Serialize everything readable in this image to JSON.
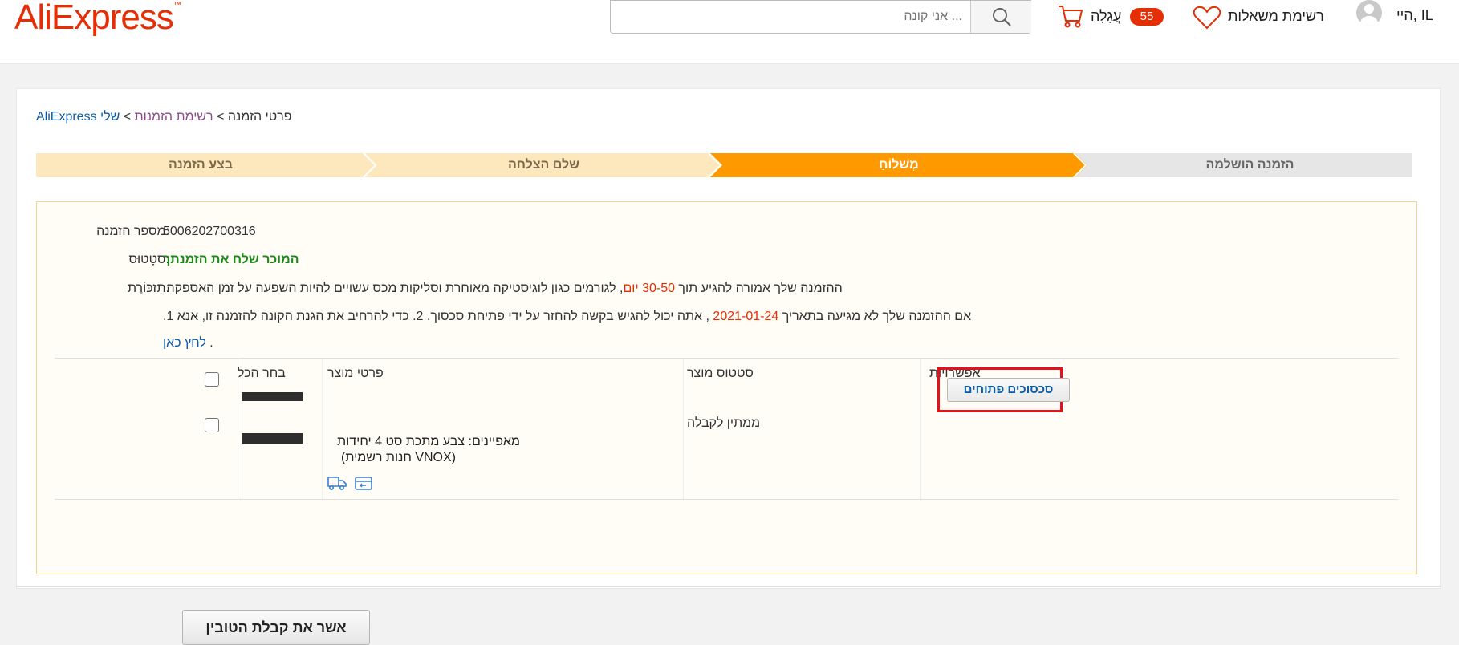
{
  "header": {
    "logo": "AliExpress",
    "logo_tm": "™",
    "search_placeholder": "... אני קונה",
    "cart_label": "עֲגָלָה",
    "cart_count": "55",
    "wishlist_label": "רשימת משאלות",
    "account_greeting": "היי, IL"
  },
  "breadcrumb": {
    "home": "AliExpress",
    "sep1": " > ",
    "mine": "שלי",
    "orders": "רשימת הזמנות",
    "sep2": "> ",
    "current": "פרטי הזמנה"
  },
  "steps": [
    {
      "label": "הזמנה הושלמה",
      "state": "pending"
    },
    {
      "label": "מְשׁלוֹחַ",
      "state": "active"
    },
    {
      "label": "שלם הצלחה",
      "state": "done"
    },
    {
      "label": "בצע הזמנה",
      "state": "done"
    }
  ],
  "order": {
    "number_label": "מספר הזמנה:",
    "number_value": "5006202700316",
    "status_label": "סטָטוּס:",
    "status_value": "המוכר שלח את הזמנתך",
    "reminder_label": "תִזכּוֹרֶת:",
    "reminder_line1_a": "ההזמנה שלך אמורה להגיע תוך ",
    "reminder_line1_days": "30-50 יום",
    "reminder_line1_b": ", לגורמים כגון לוגיסטיקה מאוחרת וסליקות מכס עשויים להיות השפעה על זמן האספקה.",
    "reminder_line2_a": "אם ההזמנה שלך לא מגיעה בתאריך ",
    "reminder_line2_date": "2021-01-24",
    "reminder_line2_b": " , אתה יכול להגיש בקשה להחזר על ידי פתיחת סכסוך. 2. כדי להרחיב את הגנת הקונה להזמנה זו, אנא 1.",
    "reminder_link": "לחץ כאן",
    "reminder_link_suffix": " ."
  },
  "table": {
    "col_options": "אפשרויות",
    "col_status": "סטטוס מוצר",
    "col_details": "פרטי מוצר",
    "col_select_all": "בחר הכל",
    "item": {
      "status": "ממתין לקבלה",
      "properties": "מאפיינים: צבע מתכת סט 4 יחידות",
      "store": "(VNOX חנות רשמית)",
      "dispute_button": "סכסוכים פתוחים"
    }
  },
  "confirm_button": "אשר את קבלת הטובין",
  "colors": {
    "brand": "#e62e04",
    "step_active": "#ff9900",
    "step_done": "#fde8be",
    "step_pending": "#e6e6e6",
    "link": "#0b5ba8",
    "status_green": "#1a8a1a",
    "highlight": "#e3131c"
  },
  "icons": [
    "search-icon",
    "cart-icon",
    "heart-icon",
    "avatar-icon",
    "shipping-truck-icon",
    "store-box-icon"
  ]
}
